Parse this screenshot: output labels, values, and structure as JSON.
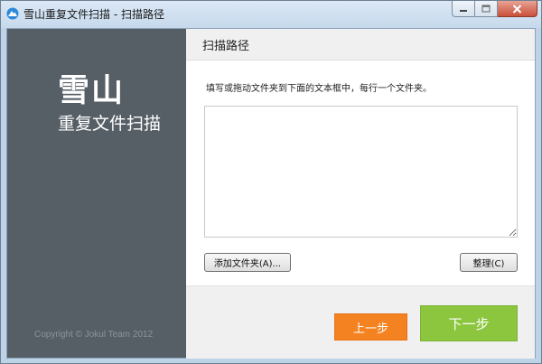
{
  "window": {
    "title": "雪山重复文件扫描 - 扫描路径",
    "app_icon": "snow-mountain-app-icon"
  },
  "sidebar": {
    "logo_main": "雪山",
    "logo_sub": "重复文件扫描",
    "copyright": "Copyright © Jokul Team 2012"
  },
  "header": {
    "title": "扫描路径"
  },
  "content": {
    "instruction": "填写或拖动文件夹到下面的文本框中，每行一个文件夹。",
    "paths_value": "",
    "add_folder_label": "添加文件夹(A)...",
    "tidy_label": "整理(C)"
  },
  "footer": {
    "prev_label": "上一步",
    "next_label": "下一步"
  },
  "colors": {
    "sidebar_bg": "#575f66",
    "prev_button": "#f58220",
    "next_button": "#8cc63f"
  }
}
